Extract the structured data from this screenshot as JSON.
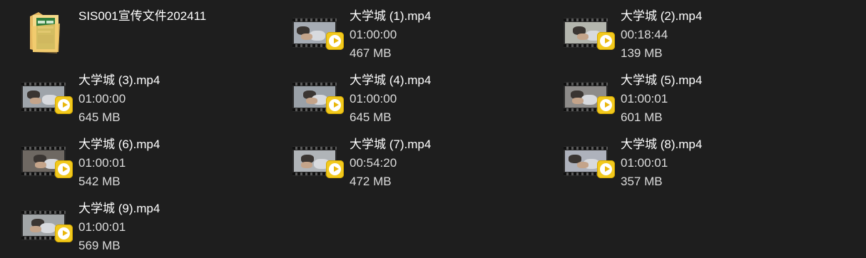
{
  "folder": {
    "name": "SIS001宣传文件202411",
    "icon": "folder-icon"
  },
  "videos": [
    {
      "name": "大学城 (1).mp4",
      "duration": "01:00:00",
      "size": "467 MB",
      "tone": "#a6acb4"
    },
    {
      "name": "大学城 (2).mp4",
      "duration": "00:18:44",
      "size": "139 MB",
      "tone": "#b4b6ae"
    },
    {
      "name": "大学城 (3).mp4",
      "duration": "01:00:00",
      "size": "645 MB",
      "tone": "#9ea4aa"
    },
    {
      "name": "大学城 (4).mp4",
      "duration": "01:00:00",
      "size": "645 MB",
      "tone": "#9aa1a8"
    },
    {
      "name": "大学城 (5).mp4",
      "duration": "01:00:01",
      "size": "601 MB",
      "tone": "#8e8c8a"
    },
    {
      "name": "大学城 (6).mp4",
      "duration": "01:00:01",
      "size": "542 MB",
      "tone": "#6e6862"
    },
    {
      "name": "大学城 (7).mp4",
      "duration": "00:54:20",
      "size": "472 MB",
      "tone": "#b0b4b8"
    },
    {
      "name": "大学城 (8).mp4",
      "duration": "01:00:01",
      "size": "357 MB",
      "tone": "#aeb2bc"
    },
    {
      "name": "大学城 (9).mp4",
      "duration": "01:00:01",
      "size": "569 MB",
      "tone": "#a2a6a8"
    }
  ],
  "icons": {
    "video_thumbnail": "video-thumbnail-icon",
    "play_badge": "play-badge-icon"
  },
  "colors": {
    "background": "#1e1e1e",
    "text": "#ffffff",
    "play_badge": "#f2c91d"
  }
}
